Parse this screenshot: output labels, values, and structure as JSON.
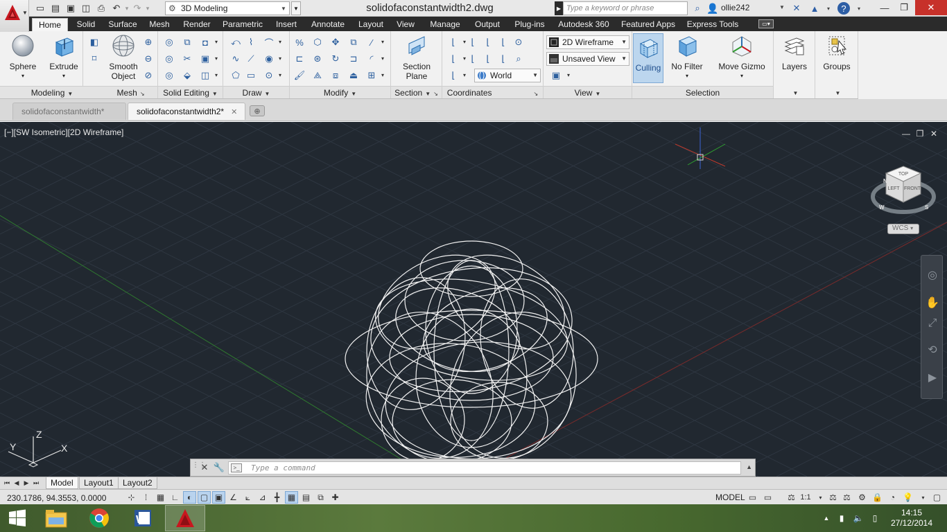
{
  "title_bar": {
    "workspace": "3D Modeling",
    "document_title": "solidofaconstantwidth2.dwg",
    "search_placeholder": "Type a keyword or phrase",
    "username": "ollie242"
  },
  "ribbon_tabs": [
    "Home",
    "Solid",
    "Surface",
    "Mesh",
    "Render",
    "Parametric",
    "Insert",
    "Annotate",
    "Layout",
    "View",
    "Manage",
    "Output",
    "Plug-ins",
    "Autodesk 360",
    "Featured Apps",
    "Express Tools"
  ],
  "active_ribbon_tab": "Home",
  "ribbon": {
    "modeling": {
      "title": "Modeling",
      "sphere": "Sphere",
      "extrude": "Extrude"
    },
    "mesh": {
      "title": "Mesh",
      "smooth_object_1": "Smooth",
      "smooth_object_2": "Object"
    },
    "solid_editing": {
      "title": "Solid Editing"
    },
    "draw": {
      "title": "Draw"
    },
    "modify": {
      "title": "Modify"
    },
    "section": {
      "title": "Section",
      "section_plane_1": "Section",
      "section_plane_2": "Plane"
    },
    "coordinates": {
      "title": "Coordinates",
      "ucs_value": "World"
    },
    "view": {
      "title": "View",
      "visual_style": "2D Wireframe",
      "named_view": "Unsaved View"
    },
    "selection": {
      "title": "Selection",
      "culling": "Culling",
      "no_filter": "No Filter",
      "move_gizmo": "Move Gizmo"
    },
    "layers": {
      "label": "Layers"
    },
    "groups": {
      "label": "Groups"
    }
  },
  "file_tabs": [
    {
      "label": "solidofaconstantwidth*",
      "active": false
    },
    {
      "label": "solidofaconstantwidth2*",
      "active": true
    }
  ],
  "viewport": {
    "label": "[−][SW Isometric][2D Wireframe]",
    "viewcube": {
      "top": "TOP",
      "left": "LEFT",
      "front": "FRONT",
      "compass_n": "N",
      "compass_w": "W",
      "compass_s": "S"
    },
    "wcs_label": "WCS",
    "ucs_icon": {
      "x": "X",
      "y": "Y",
      "z": "Z"
    }
  },
  "command_line": {
    "placeholder": "Type a command"
  },
  "layout_tabs": [
    "Model",
    "Layout1",
    "Layout2"
  ],
  "active_layout_tab": "Model",
  "status_bar": {
    "coordinates": "230.1786, 94.3553, 0.0000",
    "space": "MODEL",
    "annotation_scale": "1:1"
  },
  "taskbar": {
    "time": "14:15",
    "date": "27/12/2014"
  },
  "colors": {
    "viewport_bg": "#212830",
    "ribbon_tab_bg": "#2b2b2b",
    "culling_active": "#bcd6ee",
    "autocad_red": "#c8171f"
  }
}
